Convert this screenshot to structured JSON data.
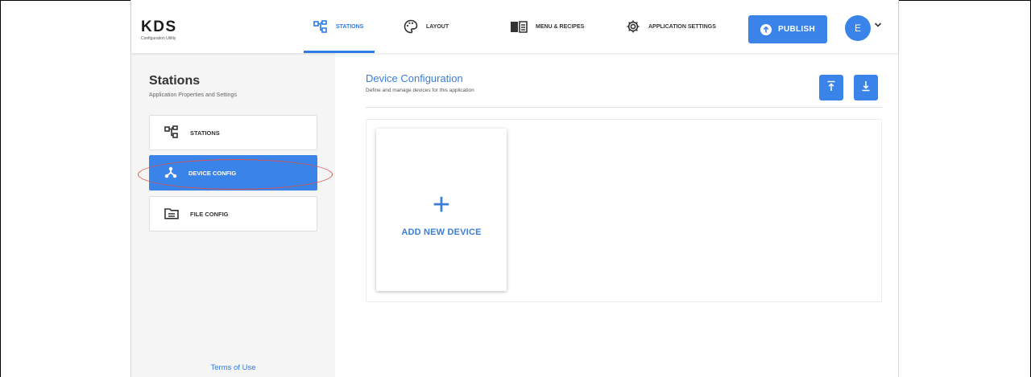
{
  "app": {
    "logo_title": "KDS",
    "logo_subtitle": "Configuration Utility",
    "accent_color": "#3a83e8"
  },
  "nav": {
    "tabs": [
      {
        "label": "STATIONS",
        "icon": "stations-icon",
        "active": true
      },
      {
        "label": "LAYOUT",
        "icon": "palette-icon",
        "active": false
      },
      {
        "label": "MENU & RECIPES",
        "icon": "book-icon",
        "active": false
      },
      {
        "label": "APPLICATION SETTINGS",
        "icon": "gear-icon",
        "active": false
      }
    ],
    "publish_label": "PUBLISH",
    "avatar_initial": "E"
  },
  "sidebar": {
    "title": "Stations",
    "subtitle": "Application Properties and Settings",
    "items": [
      {
        "label": "STATIONS",
        "icon": "stations-icon",
        "active": false
      },
      {
        "label": "DEVICE CONFIG",
        "icon": "device-config-icon",
        "active": true
      },
      {
        "label": "FILE CONFIG",
        "icon": "file-config-icon",
        "active": false
      }
    ],
    "terms_label": "Terms of Use"
  },
  "main": {
    "title": "Device Configuration",
    "subtitle": "Define and manage devices for this application",
    "upload_icon": "upload-icon",
    "download_icon": "download-icon",
    "add_card": {
      "plus": "+",
      "label": "ADD NEW DEVICE"
    }
  }
}
